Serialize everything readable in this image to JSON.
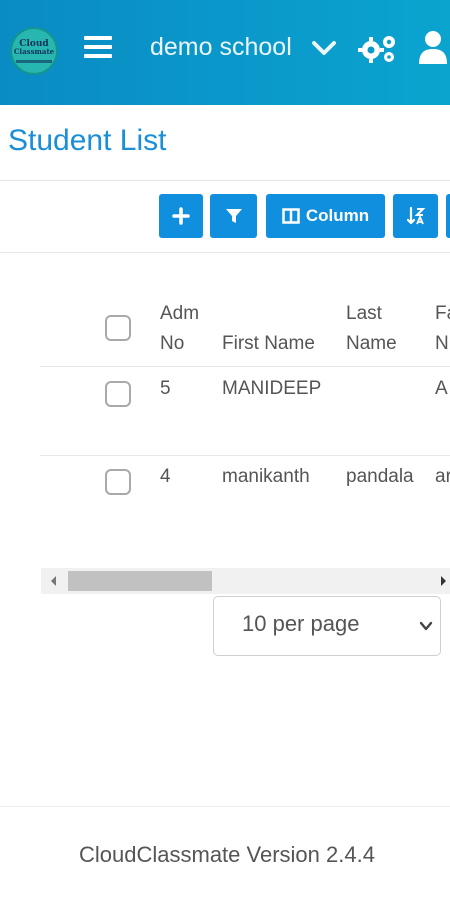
{
  "header": {
    "logo_text_line1": "Cloud",
    "logo_text_line2": "Classmate",
    "school_name": "demo school",
    "colors": {
      "header_start": "#0a8bc4",
      "header_end": "#0aa4cf",
      "accent": "#0f8fde",
      "title": "#1a8fd8"
    }
  },
  "page": {
    "title": "Student List"
  },
  "toolbar": {
    "add_icon": "plus-icon",
    "filter_icon": "filter-icon",
    "column_label": "Column",
    "column_icon": "columns-icon",
    "sort_icon": "sort-icon"
  },
  "table": {
    "headers": {
      "adm_line1": "Adm",
      "adm_line2": "No",
      "first_name": "First Name",
      "last_line1": "Last",
      "last_line2": "Name",
      "father_line1": "Fa",
      "father_line2": "N"
    },
    "rows": [
      {
        "adm_no": "5",
        "first_name": "MANIDEEP",
        "last_name": "",
        "father_name": "A"
      },
      {
        "adm_no": "4",
        "first_name": "manikanth",
        "last_name": "pandala",
        "father_name": "ar"
      }
    ]
  },
  "pagination": {
    "per_page_label": "10 per page"
  },
  "footer": {
    "version_text": "CloudClassmate Version 2.4.4"
  }
}
